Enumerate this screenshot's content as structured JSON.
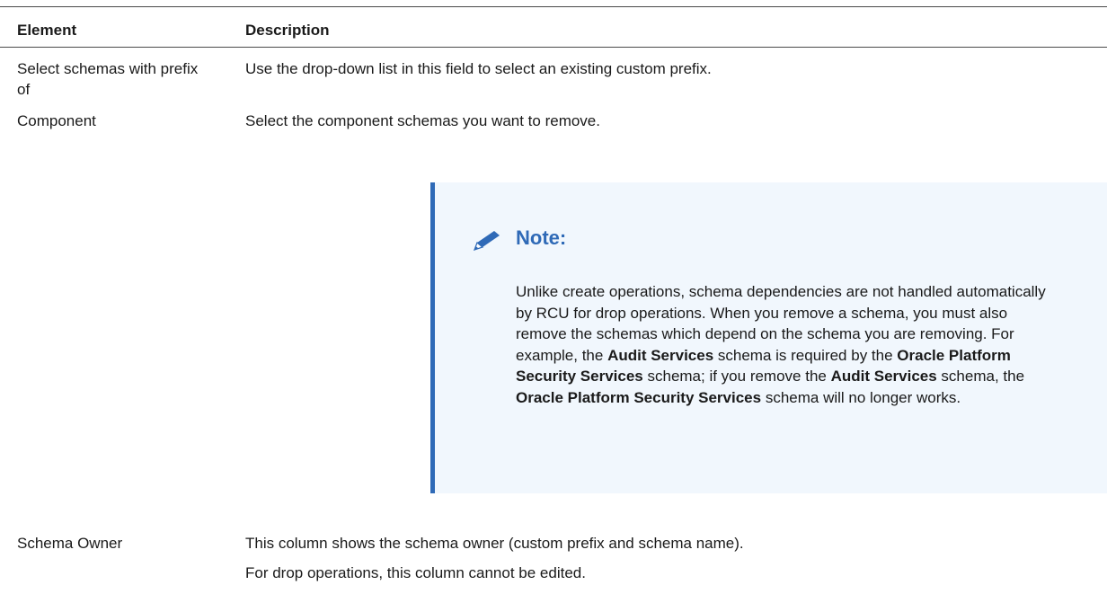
{
  "table": {
    "headers": [
      "Element",
      "Description"
    ],
    "rows": [
      {
        "element": "Select schemas with prefix of",
        "description": [
          "Use the drop-down list in this field to select an existing custom prefix."
        ]
      },
      {
        "element": "Component",
        "description": [
          "Select the component schemas you want to remove."
        ]
      },
      {
        "element": "Schema Owner",
        "description": [
          "This column shows the schema owner (custom prefix and schema name).",
          "For drop operations, this column cannot be edited."
        ]
      }
    ]
  },
  "note": {
    "icon": "pencil-icon",
    "title": "Note:",
    "segments": [
      {
        "text": "Unlike create operations, schema dependencies are not handled automatically by RCU for drop operations. When you remove a schema, you must also remove the schemas which depend on the schema you are removing. For example, the ",
        "bold": false
      },
      {
        "text": "Audit Services",
        "bold": true
      },
      {
        "text": " schema is required by the ",
        "bold": false
      },
      {
        "text": "Oracle Platform Security Services",
        "bold": true
      },
      {
        "text": " schema; if you remove the ",
        "bold": false
      },
      {
        "text": "Audit Services",
        "bold": true
      },
      {
        "text": " schema, the ",
        "bold": false
      },
      {
        "text": "Oracle Platform Security Services",
        "bold": true
      },
      {
        "text": " schema will no longer works.",
        "bold": false
      }
    ],
    "accent_color": "#2f6ab7",
    "background_color": "#f1f7fd"
  }
}
